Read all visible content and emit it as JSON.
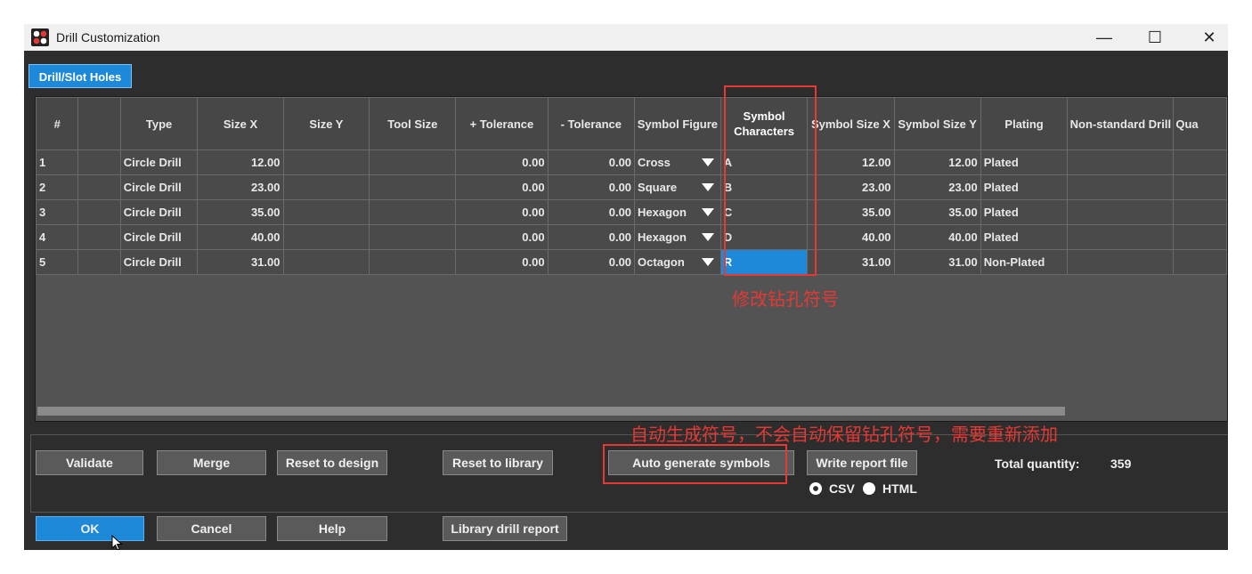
{
  "window": {
    "title": "Drill Customization",
    "minimize": "—",
    "maximize": "☐",
    "close": "✕"
  },
  "tab": {
    "label": "Drill/Slot Holes"
  },
  "columns": [
    "#",
    "",
    "Type",
    "Size X",
    "Size Y",
    "Tool Size",
    "+ Tolerance",
    "- Tolerance",
    "Symbol Figure",
    "Symbol Characters",
    "Symbol Size X",
    "Symbol Size Y",
    "Plating",
    "Non-standard Drill",
    "Qua"
  ],
  "rows": [
    {
      "num": "1",
      "type": "Circle Drill",
      "size_x": "12.00",
      "size_y": "",
      "tool": "",
      "plus_tol": "0.00",
      "minus_tol": "0.00",
      "figure": "Cross",
      "symbol": "A",
      "sym_x": "12.00",
      "sym_y": "12.00",
      "plating": "Plated",
      "nonstd": "",
      "qty": ""
    },
    {
      "num": "2",
      "type": "Circle Drill",
      "size_x": "23.00",
      "size_y": "",
      "tool": "",
      "plus_tol": "0.00",
      "minus_tol": "0.00",
      "figure": "Square",
      "symbol": "B",
      "sym_x": "23.00",
      "sym_y": "23.00",
      "plating": "Plated",
      "nonstd": "",
      "qty": ""
    },
    {
      "num": "3",
      "type": "Circle Drill",
      "size_x": "35.00",
      "size_y": "",
      "tool": "",
      "plus_tol": "0.00",
      "minus_tol": "0.00",
      "figure": "Hexagon",
      "symbol": "C",
      "sym_x": "35.00",
      "sym_y": "35.00",
      "plating": "Plated",
      "nonstd": "",
      "qty": ""
    },
    {
      "num": "4",
      "type": "Circle Drill",
      "size_x": "40.00",
      "size_y": "",
      "tool": "",
      "plus_tol": "0.00",
      "minus_tol": "0.00",
      "figure": "Hexagon",
      "symbol": "D",
      "sym_x": "40.00",
      "sym_y": "40.00",
      "plating": "Plated",
      "nonstd": "",
      "qty": ""
    },
    {
      "num": "5",
      "type": "Circle Drill",
      "size_x": "31.00",
      "size_y": "",
      "tool": "",
      "plus_tol": "0.00",
      "minus_tol": "0.00",
      "figure": "Octagon",
      "symbol": "R",
      "sym_x": "31.00",
      "sym_y": "31.00",
      "plating": "Non-Plated",
      "nonstd": "",
      "qty": ""
    }
  ],
  "selected_row": 4,
  "annotations": {
    "symbol_note": "修改钻孔符号",
    "auto_note": "自动生成符号，不会自动保留钻孔符号，需要重新添加"
  },
  "buttons": {
    "validate": "Validate",
    "merge": "Merge",
    "reset_design": "Reset to design",
    "reset_library": "Reset to library",
    "auto_generate": "Auto generate symbols",
    "write_report": "Write report file",
    "ok": "OK",
    "cancel": "Cancel",
    "help": "Help",
    "library_report": "Library drill report"
  },
  "report": {
    "format_options": [
      "CSV",
      "HTML"
    ],
    "selected_format": "CSV"
  },
  "total": {
    "label": "Total quantity:",
    "value": "359"
  },
  "colors": {
    "accent": "#1e88d9",
    "annotation": "#e53935",
    "symbol_text": "#2196f3",
    "window_bg": "#2d2d2d"
  },
  "icons": {
    "app": "drill-app-icon",
    "dropdown": "dropdown-arrow-icon",
    "cursor": "mouse-cursor-icon"
  }
}
